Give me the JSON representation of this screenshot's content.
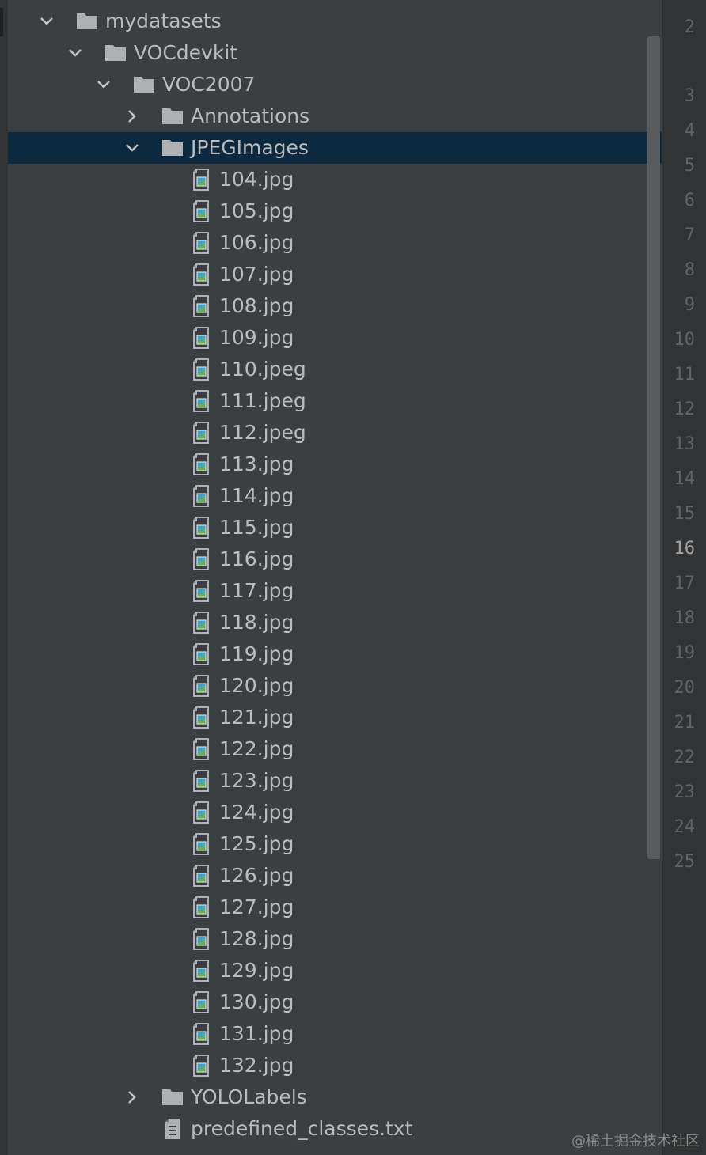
{
  "tree": [
    {
      "label": "mydatasets",
      "type": "folder",
      "depth": 0,
      "expanded": true
    },
    {
      "label": "VOCdevkit",
      "type": "folder",
      "depth": 1,
      "expanded": true
    },
    {
      "label": "VOC2007",
      "type": "folder",
      "depth": 2,
      "expanded": true
    },
    {
      "label": "Annotations",
      "type": "folder",
      "depth": 3,
      "expanded": false
    },
    {
      "label": "JPEGImages",
      "type": "folder",
      "depth": 3,
      "expanded": true,
      "selected": true
    },
    {
      "label": "104.jpg",
      "type": "image",
      "depth": 4
    },
    {
      "label": "105.jpg",
      "type": "image",
      "depth": 4
    },
    {
      "label": "106.jpg",
      "type": "image",
      "depth": 4
    },
    {
      "label": "107.jpg",
      "type": "image",
      "depth": 4
    },
    {
      "label": "108.jpg",
      "type": "image",
      "depth": 4
    },
    {
      "label": "109.jpg",
      "type": "image",
      "depth": 4
    },
    {
      "label": "110.jpeg",
      "type": "image",
      "depth": 4
    },
    {
      "label": "111.jpeg",
      "type": "image",
      "depth": 4
    },
    {
      "label": "112.jpeg",
      "type": "image",
      "depth": 4
    },
    {
      "label": "113.jpg",
      "type": "image",
      "depth": 4
    },
    {
      "label": "114.jpg",
      "type": "image",
      "depth": 4
    },
    {
      "label": "115.jpg",
      "type": "image",
      "depth": 4
    },
    {
      "label": "116.jpg",
      "type": "image",
      "depth": 4
    },
    {
      "label": "117.jpg",
      "type": "image",
      "depth": 4
    },
    {
      "label": "118.jpg",
      "type": "image",
      "depth": 4
    },
    {
      "label": "119.jpg",
      "type": "image",
      "depth": 4
    },
    {
      "label": "120.jpg",
      "type": "image",
      "depth": 4
    },
    {
      "label": "121.jpg",
      "type": "image",
      "depth": 4
    },
    {
      "label": "122.jpg",
      "type": "image",
      "depth": 4
    },
    {
      "label": "123.jpg",
      "type": "image",
      "depth": 4
    },
    {
      "label": "124.jpg",
      "type": "image",
      "depth": 4
    },
    {
      "label": "125.jpg",
      "type": "image",
      "depth": 4
    },
    {
      "label": "126.jpg",
      "type": "image",
      "depth": 4
    },
    {
      "label": "127.jpg",
      "type": "image",
      "depth": 4
    },
    {
      "label": "128.jpg",
      "type": "image",
      "depth": 4
    },
    {
      "label": "129.jpg",
      "type": "image",
      "depth": 4
    },
    {
      "label": "130.jpg",
      "type": "image",
      "depth": 4
    },
    {
      "label": "131.jpg",
      "type": "image",
      "depth": 4
    },
    {
      "label": "132.jpg",
      "type": "image",
      "depth": 4
    },
    {
      "label": "YOLOLabels",
      "type": "folder",
      "depth": 3,
      "expanded": false
    },
    {
      "label": "predefined_classes.txt",
      "type": "text",
      "depth": 3
    }
  ],
  "line_numbers": [
    "2",
    "3",
    "4",
    "5",
    "6",
    "7",
    "8",
    "9",
    "10",
    "11",
    "12",
    "13",
    "14",
    "15",
    "16",
    "17",
    "18",
    "19",
    "20",
    "21",
    "22",
    "23",
    "24",
    "25"
  ],
  "current_line": "16",
  "watermark": "@稀土掘金技术社区",
  "colors": {
    "background": "#3c3f41",
    "selection": "#0d293e",
    "text": "#bbbbbb",
    "folder_icon": "#aeb1b4",
    "gutter": "#313335",
    "line_number": "#606366",
    "image_icon_blue": "#40a9c9",
    "image_icon_green": "#62b543"
  }
}
